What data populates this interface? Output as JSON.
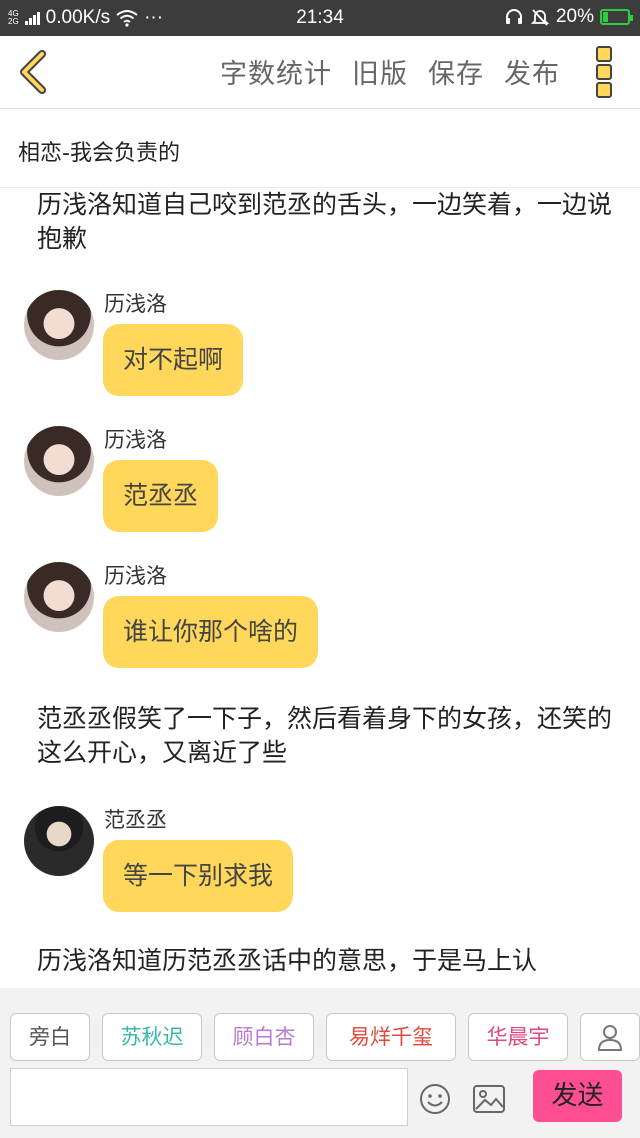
{
  "status_bar": {
    "network_label_top": "4G",
    "network_label_bottom": "2G",
    "speed": "0.00K/s",
    "more": "···",
    "time": "21:34",
    "battery": "20%",
    "battery_level": 0.2
  },
  "toolbar": {
    "word_count": "字数统计",
    "old_version": "旧版",
    "save": "保存",
    "publish": "发布"
  },
  "doc": {
    "title": "相恋-我会负责的"
  },
  "story": {
    "narration_1": "历浅洛知道自己咬到范丞的舌头，一边笑着，一边说抱歉",
    "messages": [
      {
        "name": "历浅洛",
        "text": "对不起啊"
      },
      {
        "name": "历浅洛",
        "text": "范丞丞"
      },
      {
        "name": "历浅洛",
        "text": "谁让你那个啥的"
      }
    ],
    "narration_2": "范丞丞假笑了一下子，然后看着身下的女孩，还笑的这么开心，又离近了些",
    "message_boy": {
      "name": "范丞丞",
      "text": "等一下别求我"
    },
    "narration_3": "历浅洛知道历范丞丞话中的意思，于是马上认"
  },
  "roles": [
    {
      "label": "旁白",
      "color": "#555555"
    },
    {
      "label": "苏秋迟",
      "color": "#3cb8a8"
    },
    {
      "label": "顾白杏",
      "color": "#b87ad0"
    },
    {
      "label": "易烊千玺",
      "color": "#e0483c"
    },
    {
      "label": "华晨宇",
      "color": "#e0487a"
    }
  ],
  "composer": {
    "input_value": "",
    "send": "发送"
  }
}
